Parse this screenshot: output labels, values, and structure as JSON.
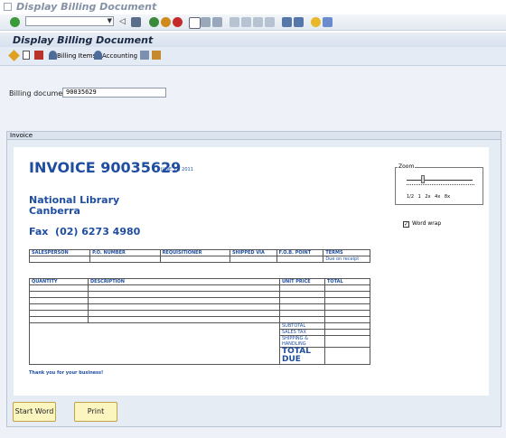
{
  "window": {
    "title": "Display Billing Document"
  },
  "toolbar": {
    "command_value": ""
  },
  "app": {
    "title": "Display Billing Document",
    "actions": [
      {
        "label": "Billing Items",
        "icon": "person-icon"
      },
      {
        "label": "Accounting",
        "icon": "person-icon"
      }
    ]
  },
  "billing": {
    "label": "Billing document",
    "value": "90035629"
  },
  "group": {
    "label": "Invoice"
  },
  "invoice": {
    "heading": "INVOICE 90035629",
    "date": "JUNE 12, 2011",
    "company_line1": "National Library",
    "company_line2": "Canberra",
    "fax": "Fax  (02) 6273 4980",
    "header_cols": [
      "SALESPERSON",
      "P.O. NUMBER",
      "REQUISITIONER",
      "SHIPPED VIA",
      "F.O.B. POINT",
      "TERMS"
    ],
    "header_vals": [
      "",
      "",
      "",
      "",
      "",
      "Due on receipt"
    ],
    "item_cols": [
      "QUANTITY",
      "DESCRIPTION",
      "UNIT PRICE",
      "TOTAL"
    ],
    "subtotal": "SUBTOTAL",
    "sales_tax": "SALES TAX",
    "shipping": "SHIPPING & HANDLING",
    "total_due": "TOTAL DUE",
    "thanks": "Thank you for your business!"
  },
  "zoom": {
    "label": "Zoom",
    "ticks": [
      "1/2",
      "1",
      "2x",
      "4x",
      "8x"
    ],
    "level": 0.25
  },
  "wordwrap": {
    "label": "Word wrap",
    "checked": true
  },
  "buttons": {
    "start_word": "Start Word",
    "print": "Print"
  },
  "colors": {
    "accent": "#1f4ea0",
    "button_bg": "#fbf5c0",
    "header_bg": "#d6e0ee"
  }
}
